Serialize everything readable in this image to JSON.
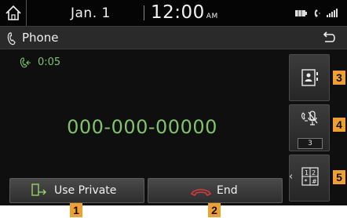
{
  "status_bar": {
    "date": "Jan. 1",
    "time": "12:00",
    "ampm": "AM"
  },
  "title_bar": {
    "title": "Phone"
  },
  "call": {
    "elapsed": "0:05",
    "number": "000-000-00000"
  },
  "side_buttons": {
    "mic_volume": "3"
  },
  "bottom_buttons": {
    "use_private": "Use Private",
    "end": "End"
  },
  "callouts": [
    "1",
    "2",
    "3",
    "4",
    "5"
  ],
  "colors": {
    "accent_green": "#7fc36d",
    "end_red": "#d93b3b",
    "badge_orange": "#f0a030"
  }
}
